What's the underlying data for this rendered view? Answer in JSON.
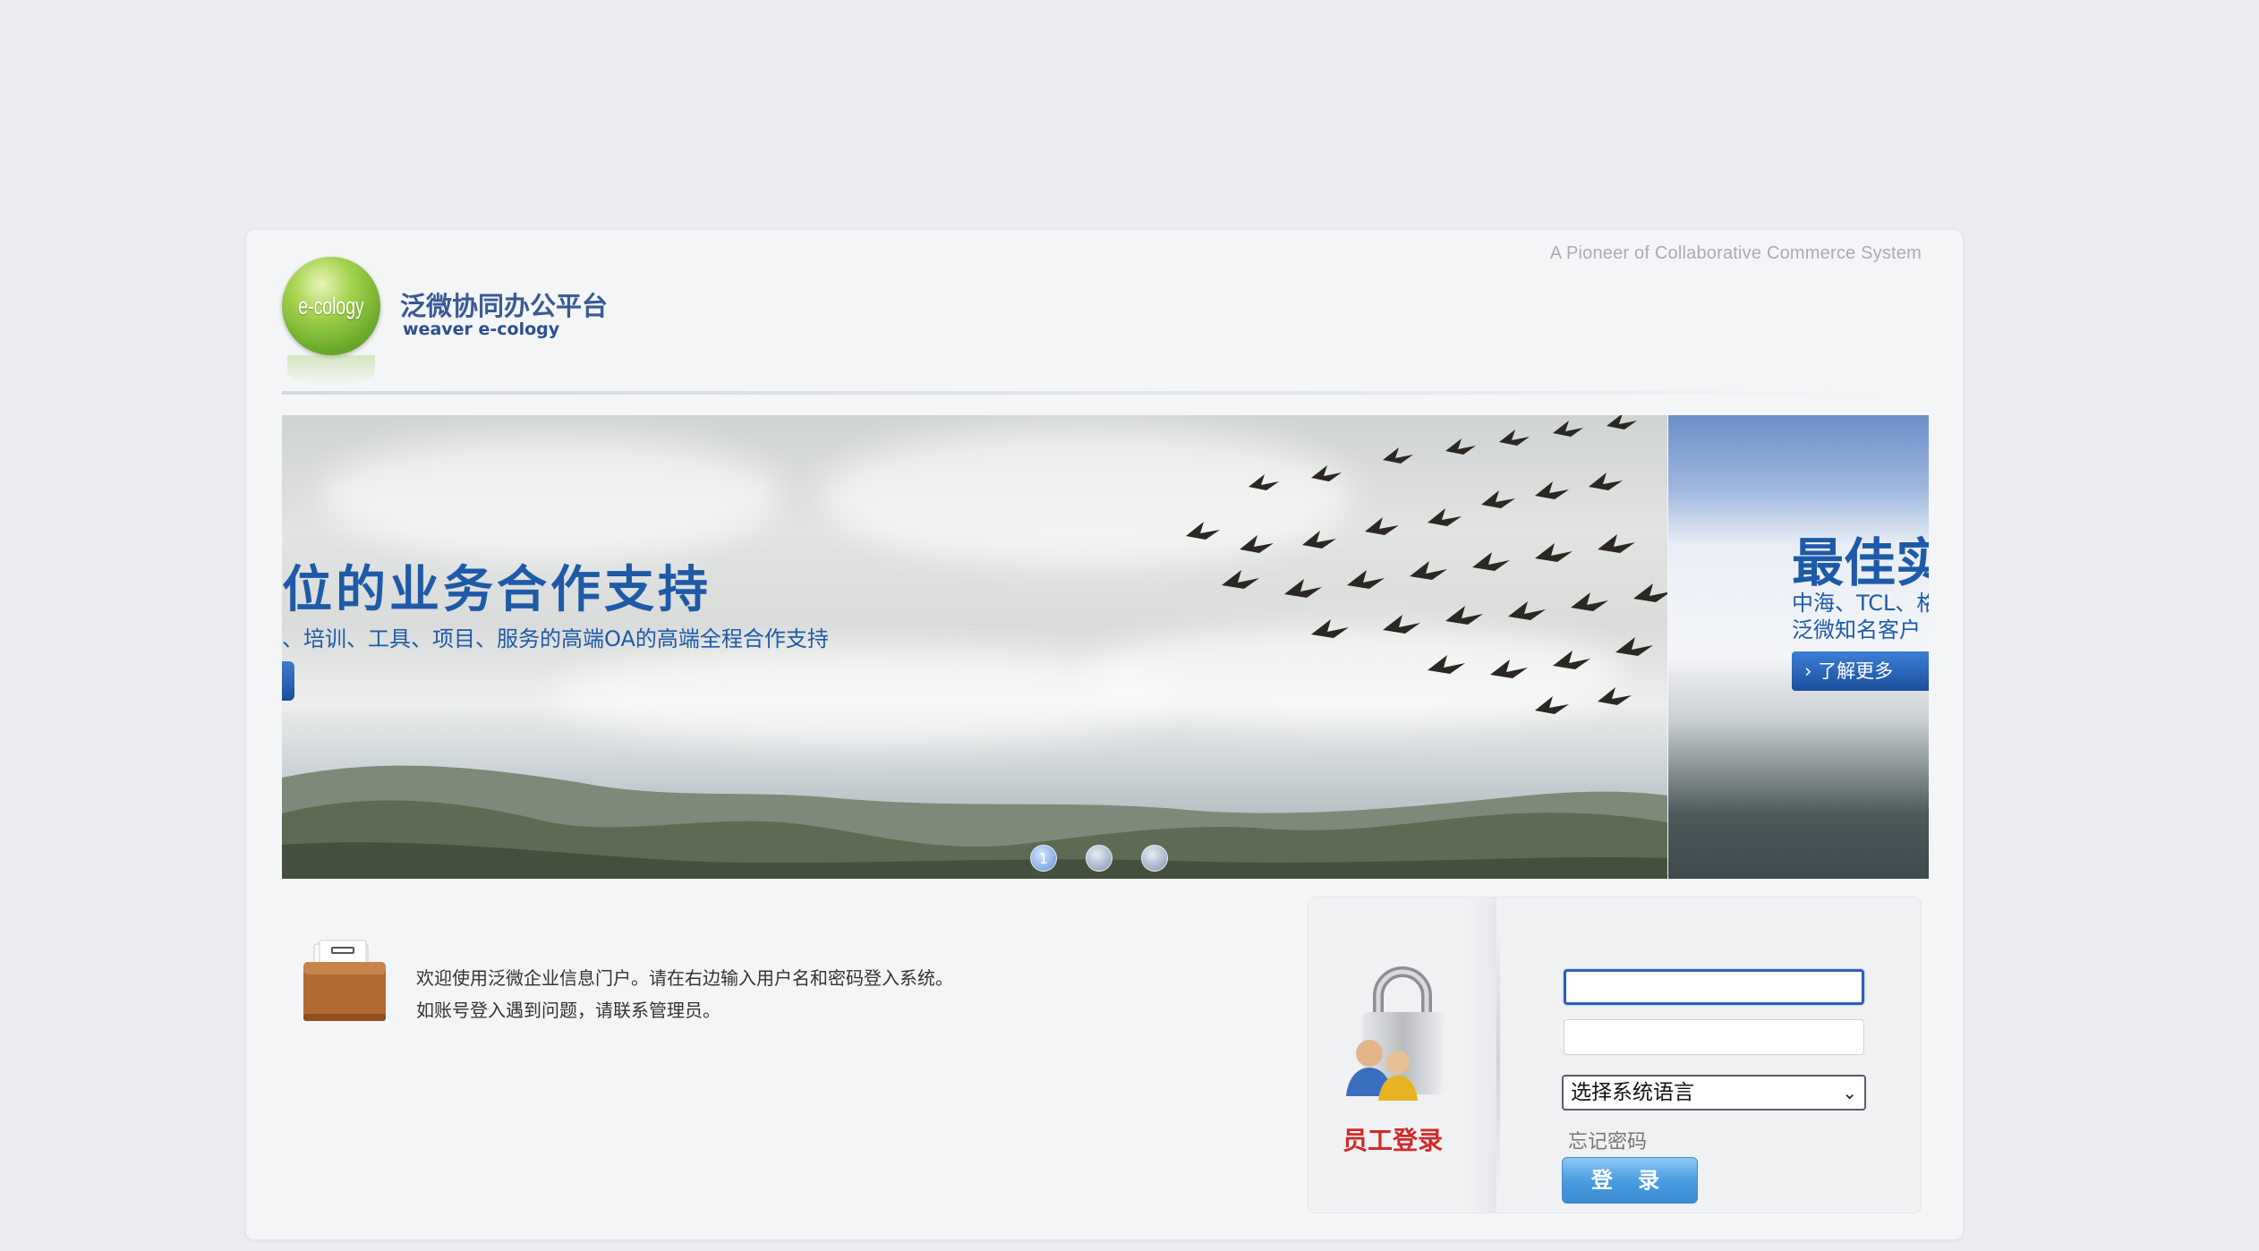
{
  "header": {
    "tagline": "A Pioneer of Collaborative Commerce System",
    "logo_text": "e-cology",
    "brand_cn": "泛微协同办公平台",
    "brand_en": "weaver e-cology"
  },
  "banner": {
    "title": "位的业务合作支持",
    "subtitle": "、培训、工具、项目、服务的高端OA的高端全程合作支持",
    "dots": [
      "1",
      "",
      ""
    ]
  },
  "banner2": {
    "title": "最佳实",
    "line1": "中海、TCL、格",
    "line2": "泛微知名客户",
    "button": "了解更多"
  },
  "welcome": {
    "line1": "欢迎使用泛微企业信息门户。请在右边输入用户名和密码登入系统。",
    "line2": "如账号登入遇到问题，请联系管理员。"
  },
  "login": {
    "title": "员工登录",
    "username_value": "",
    "password_value": "",
    "language_select": "选择系统语言",
    "forgot": "忘记密码",
    "submit": "登 录"
  }
}
